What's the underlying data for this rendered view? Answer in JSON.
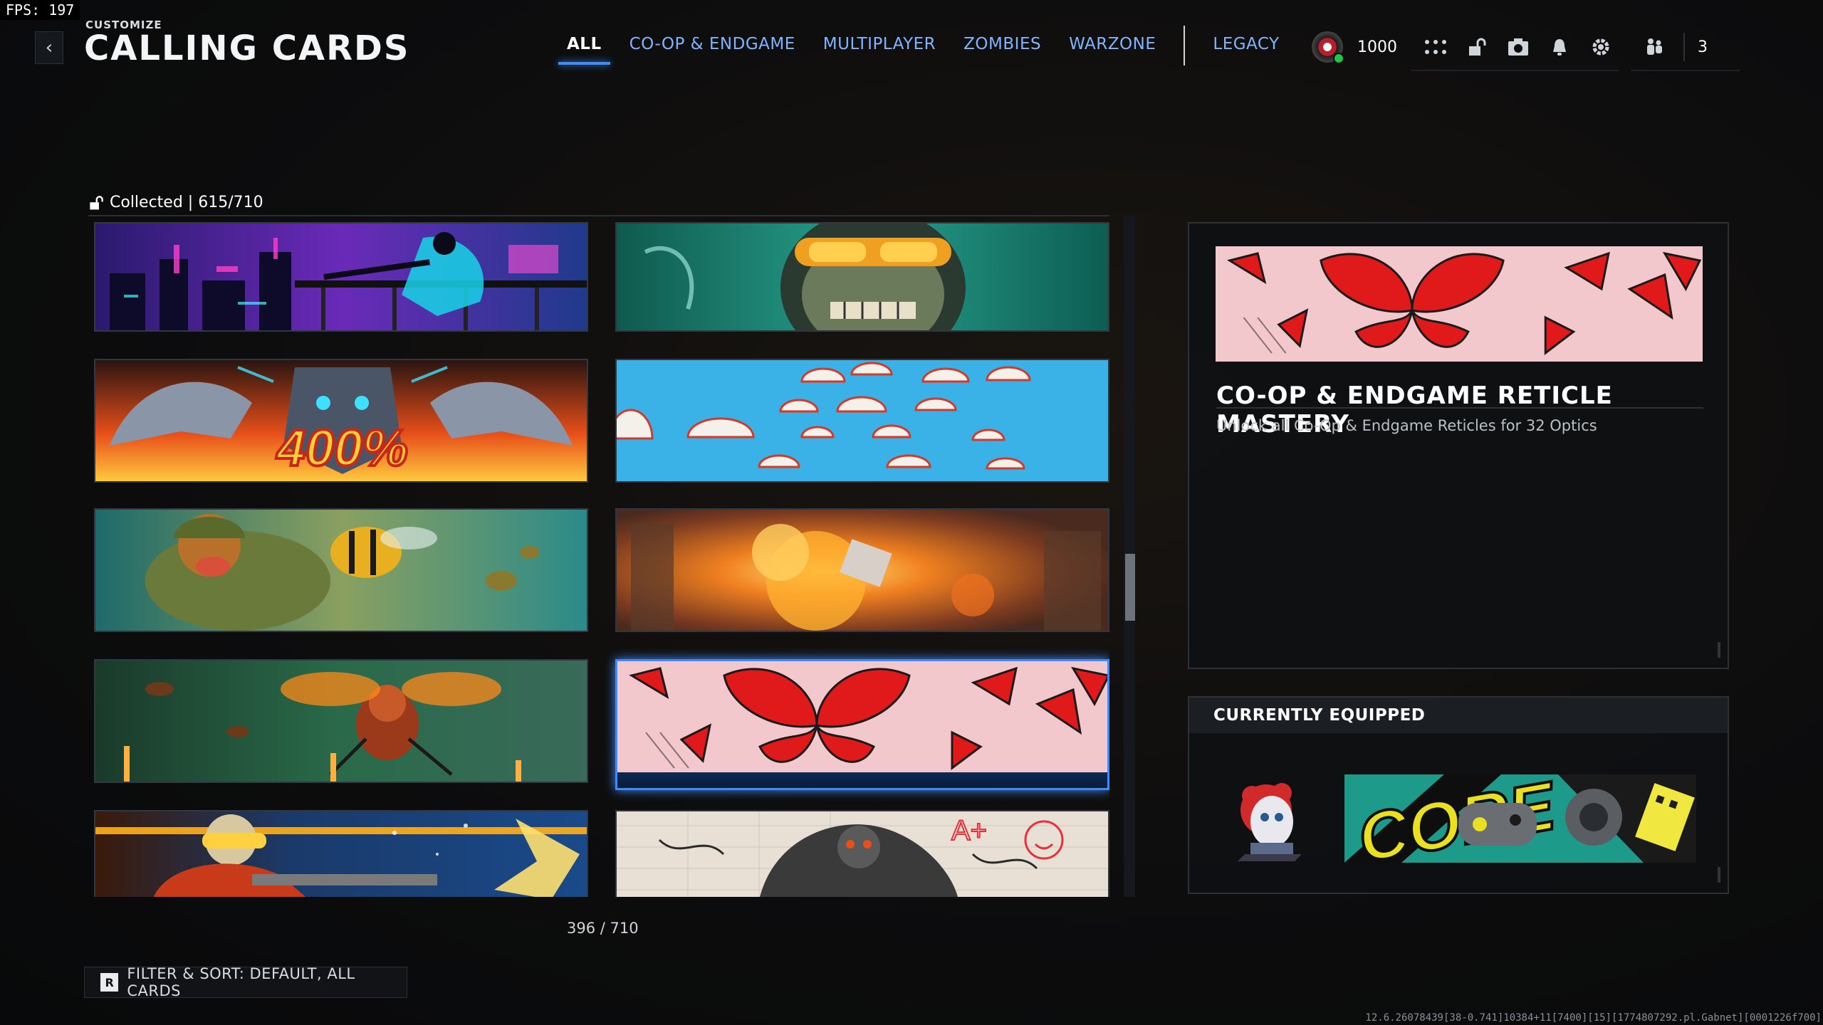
{
  "fps": "FPS: 197",
  "header": {
    "crumb": "CUSTOMIZE",
    "title": "CALLING CARDS",
    "back_icon": "chevron-left-icon"
  },
  "tabs": [
    {
      "label": "ALL",
      "active": true
    },
    {
      "label": "CO-OP & ENDGAME",
      "active": false
    },
    {
      "label": "MULTIPLAYER",
      "active": false
    },
    {
      "label": "ZOMBIES",
      "active": false
    },
    {
      "label": "WARZONE",
      "active": false
    },
    {
      "label": "LEGACY",
      "active": false
    }
  ],
  "topbar": {
    "credits": "1000",
    "party_count": "3",
    "icons": [
      "prestige-emblem-icon",
      "apps-grid-icon",
      "unlock-icon",
      "store-icon",
      "notifications-bell-icon",
      "settings-gear-icon",
      "party-icon"
    ]
  },
  "collection": {
    "label": "Collected | 615/710",
    "count": "396 / 710"
  },
  "cards": [
    {
      "name": "cyber-city-sniper-card"
    },
    {
      "name": "goggles-soldier-card"
    },
    {
      "name": "mech-dragons-400-card",
      "text": "400%"
    },
    {
      "name": "parachute-drop-card"
    },
    {
      "name": "dog-soldier-bees-card"
    },
    {
      "name": "explosion-crate-card"
    },
    {
      "name": "mutant-wasp-card"
    },
    {
      "name": "red-butterflies-card",
      "selected": true
    },
    {
      "name": "flame-soldier-card"
    },
    {
      "name": "sketch-skull-card"
    }
  ],
  "detail": {
    "title": "CO-OP & ENDGAME RETICLE MASTERY",
    "description": "Unlock all Co-Op & Endgame Reticles for 32 Optics"
  },
  "equipped": {
    "header": "CURRENTLY EQUIPPED",
    "card_text": "CORE"
  },
  "filter": {
    "key": "R",
    "label": "FILTER & SORT: DEFAULT, ALL CARDS"
  },
  "build_string": "12.6.26078439[38-0.741]10384+11[7400][15][1774807292.pl.Gabnet][0001226f700]",
  "colors": {
    "accent": "#3d8cff",
    "tab_inactive": "#7fb4ff",
    "online": "#21c44a"
  }
}
